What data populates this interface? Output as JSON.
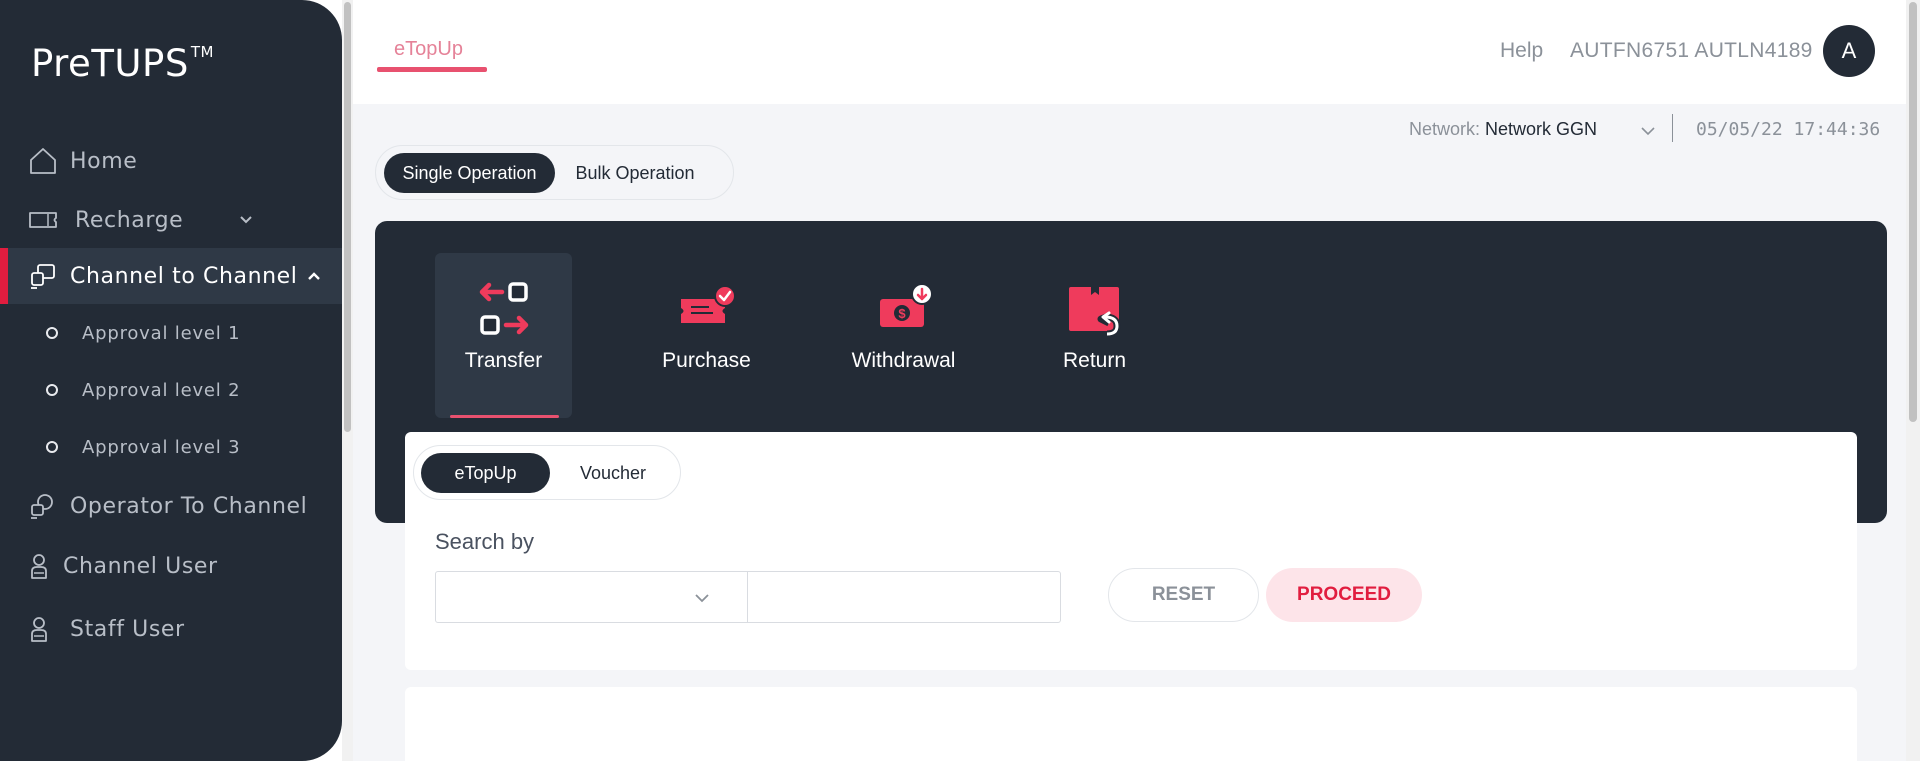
{
  "sidebar": {
    "logo": "PreTUPS",
    "logo_tm": "TM",
    "items": [
      {
        "label": "Home",
        "icon": "home-icon"
      },
      {
        "label": "Recharge",
        "icon": "ticket-icon"
      },
      {
        "label": "Channel to Channel",
        "icon": "channel-icon"
      },
      {
        "label": "Operator To Channel",
        "icon": "operator-icon"
      },
      {
        "label": "Channel User",
        "icon": "user-icon"
      },
      {
        "label": "Staff User",
        "icon": "user-icon"
      }
    ],
    "sub_items": [
      {
        "label": "Approval level 1"
      },
      {
        "label": "Approval level 2"
      },
      {
        "label": "Approval level 3"
      }
    ]
  },
  "header": {
    "tab": "eTopUp",
    "help": "Help",
    "user": "AUTFN6751 AUTLN4189",
    "avatar": "A"
  },
  "network": {
    "label": "Network:",
    "value": "Network GGN",
    "datetime": "05/05/22 17:44:36"
  },
  "operation_toggle": {
    "selected": "Single Operation",
    "other": "Bulk Operation"
  },
  "operations": [
    {
      "label": "Transfer",
      "icon": "transfer-icon"
    },
    {
      "label": "Purchase",
      "icon": "purchase-icon"
    },
    {
      "label": "Withdrawal",
      "icon": "withdrawal-icon"
    },
    {
      "label": "Return",
      "icon": "return-icon"
    }
  ],
  "sub_toggle": {
    "selected": "eTopUp",
    "other": "Voucher"
  },
  "search": {
    "label": "Search by",
    "select_value": "",
    "text_value": ""
  },
  "buttons": {
    "reset": "RESET",
    "proceed": "PROCEED"
  },
  "colors": {
    "sidebar": "#232b36",
    "accent": "#e11d3f",
    "background": "#f4f5f8"
  }
}
